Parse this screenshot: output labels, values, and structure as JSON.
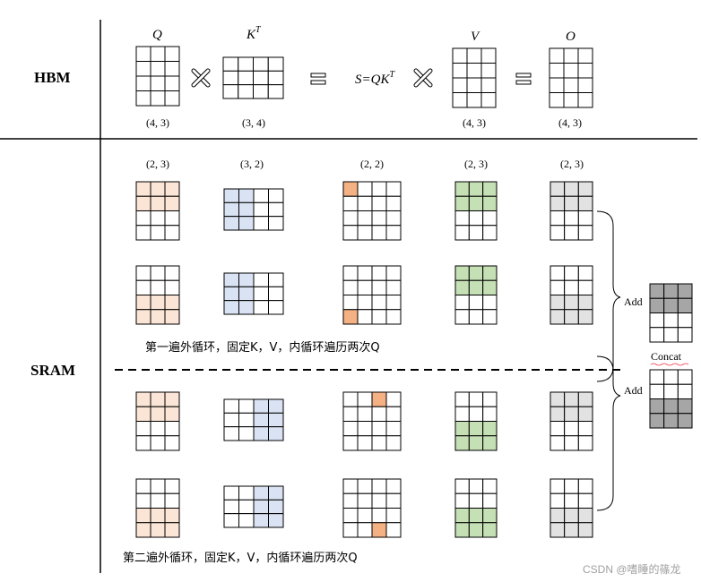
{
  "rows": {
    "hbm": "HBM",
    "sram": "SRAM"
  },
  "hbm": {
    "q_label": "Q",
    "q_shape": "(4, 3)",
    "kt_label": "K",
    "kt_sup": "T",
    "kt_shape": "(3, 4)",
    "s_label": "S=QK",
    "s_sup": "T",
    "v_label": "V",
    "v_shape": "(4, 3)",
    "o_label": "O",
    "o_shape": "(4, 3)"
  },
  "sram": {
    "shapes": [
      "(2, 3)",
      "(3, 2)",
      "(2, 2)",
      "(2, 3)",
      "(2, 3)"
    ],
    "caption1": "第一遍外循环，固定K，V，内循环遍历两次Q",
    "caption2": "第二遍外循环，固定K，V，内循环遍历两次Q",
    "add1": "Add",
    "add2": "Add",
    "concat": "Concat"
  },
  "colors": {
    "q_tile": "#fbe5d6",
    "k_tile": "#dae3f3",
    "s_tile": "#f4b183",
    "v_tile": "#c5e0b4",
    "o_tile": "#e2e2e2",
    "result_tile": "#a6a6a6"
  },
  "watermark": "CSDN @嗜睡的篠龙"
}
